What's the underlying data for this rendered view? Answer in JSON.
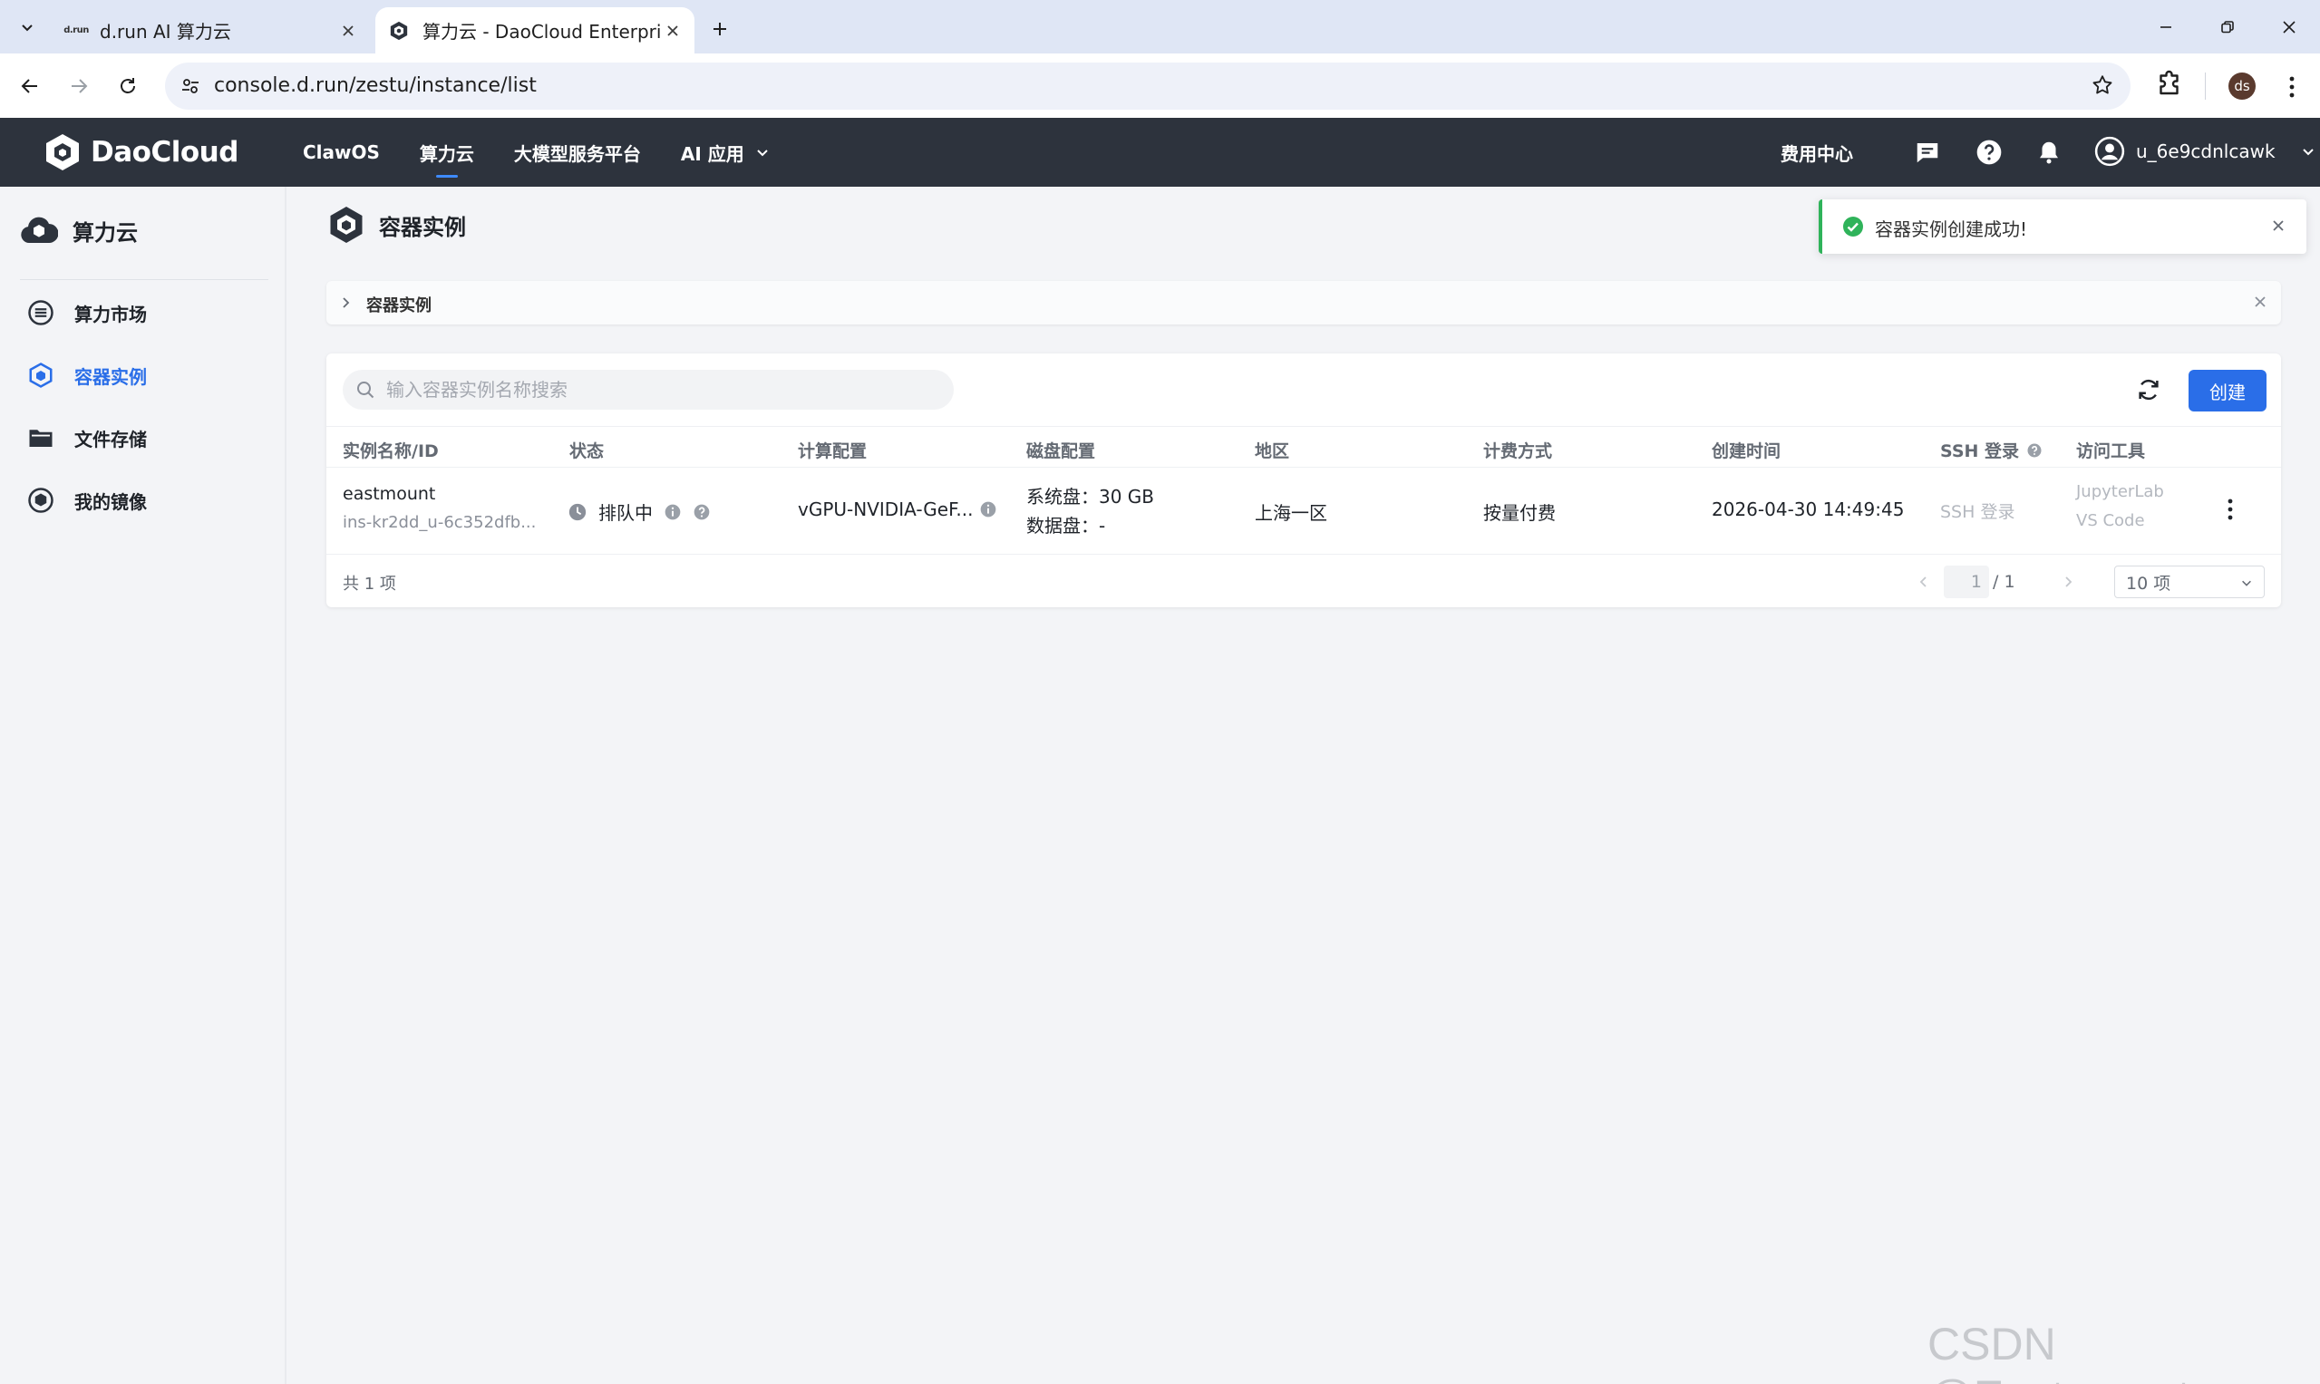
{
  "browser": {
    "tabs": [
      {
        "favicon_text": "d.run",
        "title": "d.run AI 算力云",
        "active": false
      },
      {
        "title": "算力云 - DaoCloud Enterprise",
        "active": true
      }
    ],
    "url": "console.d.run/zestu/instance/list",
    "profile_initials": "ds"
  },
  "header": {
    "brand": "DaoCloud",
    "nav": [
      {
        "label": "ClawOS",
        "active": false
      },
      {
        "label": "算力云",
        "active": true
      },
      {
        "label": "大模型服务平台",
        "active": false
      },
      {
        "label": "AI 应用",
        "active": false,
        "dropdown": true
      }
    ],
    "fee_center": "费用中心",
    "username": "u_6e9cdnlcawk"
  },
  "sidebar": {
    "title": "算力云",
    "items": [
      {
        "label": "算力市场",
        "icon": "market-icon",
        "active": false
      },
      {
        "label": "容器实例",
        "icon": "container-icon",
        "active": true
      },
      {
        "label": "文件存储",
        "icon": "folder-icon",
        "active": false
      },
      {
        "label": "我的镜像",
        "icon": "image-icon",
        "active": false
      }
    ]
  },
  "main": {
    "title": "容器实例",
    "info_bar": "容器实例",
    "search_placeholder": "输入容器实例名称搜索",
    "create_label": "创建",
    "columns": [
      "实例名称/ID",
      "状态",
      "计算配置",
      "磁盘配置",
      "地区",
      "计费方式",
      "创建时间",
      "SSH 登录",
      "访问工具"
    ],
    "rows": [
      {
        "name": "eastmount",
        "id": "ins-kr2dd_u-6c352dfb...",
        "status": "排队中",
        "compute": "vGPU-NVIDIA-GeF...",
        "disk_system": "系统盘：30 GB",
        "disk_data": "数据盘：-",
        "region": "上海一区",
        "billing": "按量付费",
        "created": "2026-04-30 14:49:45",
        "ssh": "SSH 登录",
        "tool_1": "JupyterLab",
        "tool_2": "VS Code"
      }
    ],
    "total": "共 1 项",
    "page_current": "1",
    "page_total": "/ 1",
    "page_size": "10 项"
  },
  "toast": {
    "message": "容器实例创建成功!"
  },
  "watermark": "CSDN @Eastmount",
  "colors": {
    "brand_blue": "#2a6ee8",
    "header_bg": "#2d333d",
    "success_green": "#2fb35a"
  }
}
